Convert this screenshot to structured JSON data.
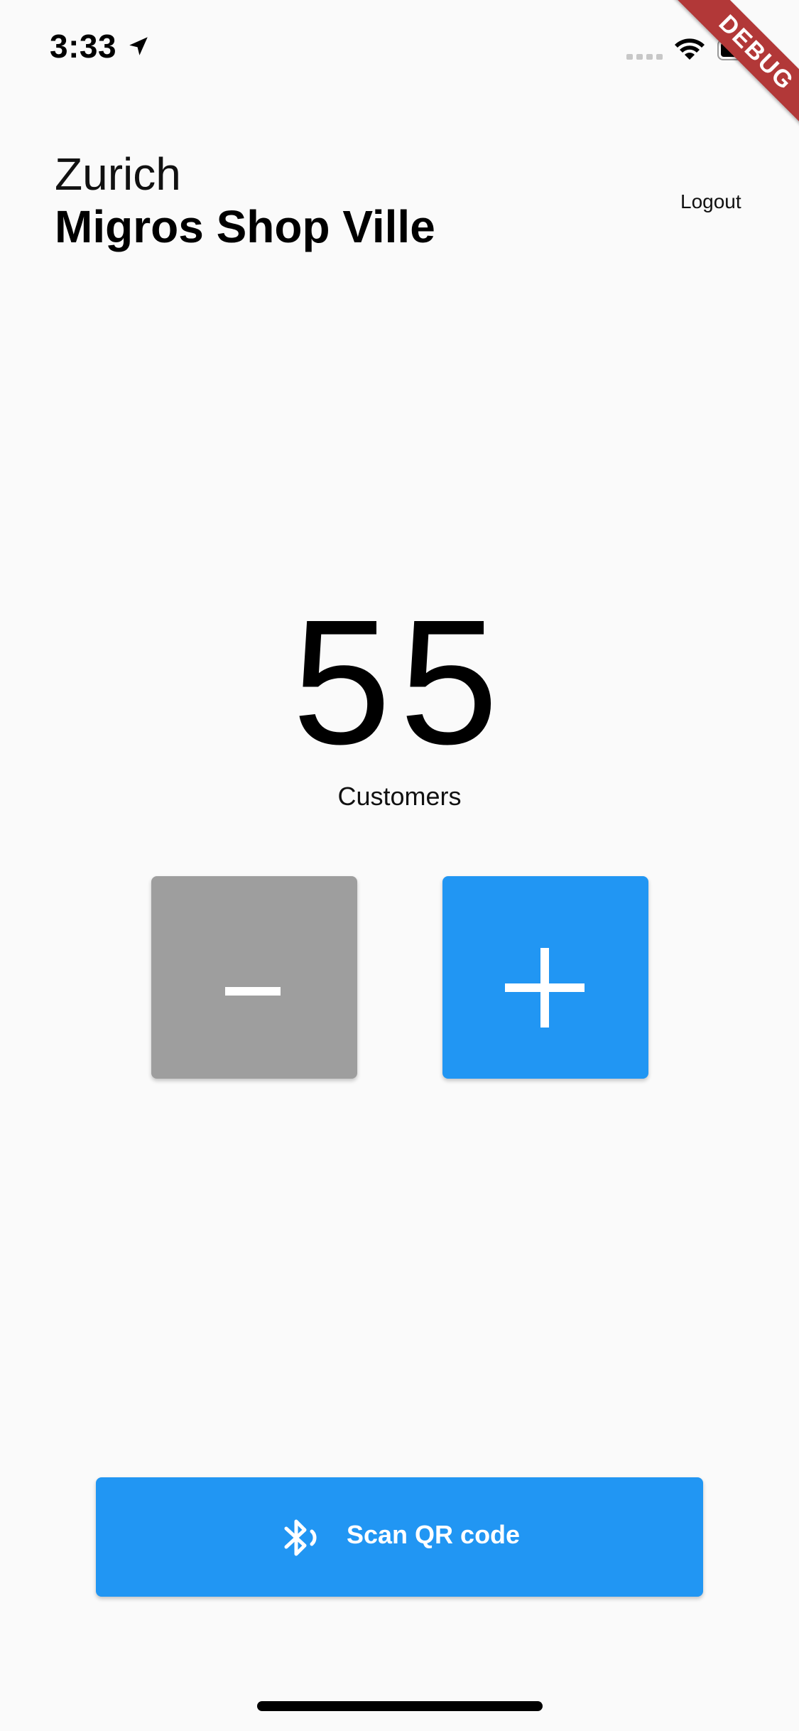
{
  "status_bar": {
    "time": "3:33"
  },
  "debug_banner": {
    "label": "DEBUG"
  },
  "header": {
    "city": "Zurich",
    "shop_name": "Migros Shop Ville",
    "logout_label": "Logout"
  },
  "counter": {
    "value": "55",
    "label": "Customers"
  },
  "controls": {
    "decrement_color": "#9e9e9e",
    "increment_color": "#2196f3"
  },
  "scan_button": {
    "label": "Scan QR code",
    "icon": "bluetooth-audio-icon",
    "color": "#2196f3"
  }
}
